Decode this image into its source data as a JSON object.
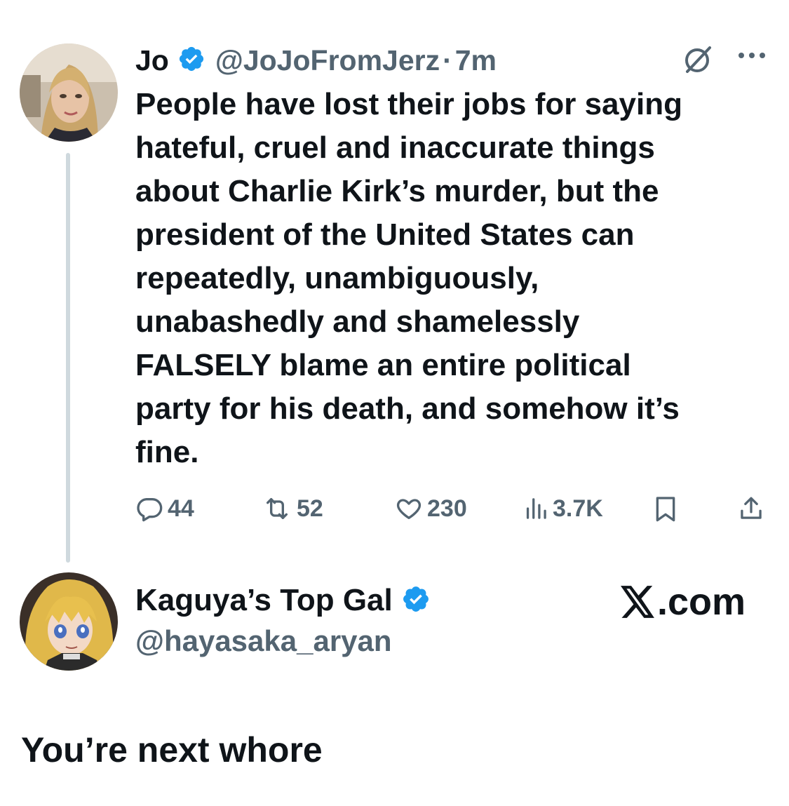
{
  "tweet": {
    "author_name": "Jo",
    "handle": "@JoJoFromJerz",
    "separator": "·",
    "time": "7m",
    "text_lines": [
      "People have lost their jobs for saying",
      "hateful, cruel and inaccurate things",
      "about Charlie Kirk’s murder, but the",
      "president of the United States can",
      "repeatedly, unambiguously,",
      "unabashedly and shamelessly",
      "FALSELY blame an entire political",
      "party for his death, and somehow it’s",
      "fine."
    ],
    "stats": {
      "replies": "44",
      "reposts": "52",
      "likes": "230",
      "views": "3.7K"
    },
    "icons": {
      "verified": "verified-badge-icon",
      "grok": "grok-icon",
      "more": "more-icon",
      "reply": "reply-icon",
      "repost": "repost-icon",
      "like": "heart-icon",
      "views": "views-icon",
      "bookmark": "bookmark-icon",
      "share": "share-icon"
    }
  },
  "reply": {
    "author_name": "Kaguya’s Top Gal",
    "handle": "@hayasaka_aryan",
    "text": "You’re next whore"
  },
  "watermark": {
    "text": ".com",
    "logo": "x-logo-icon"
  },
  "colors": {
    "text_primary": "#0f1419",
    "text_secondary": "#536471",
    "verified_blue": "#1d9bf0",
    "thread_line": "#cfd9de"
  }
}
